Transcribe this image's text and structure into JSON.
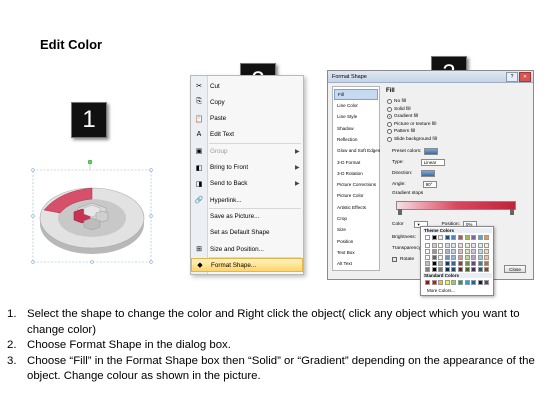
{
  "slide_title": "Edit Color",
  "badges": [
    "1",
    "2",
    "3"
  ],
  "context_menu": {
    "items": [
      {
        "label": "Cut",
        "icon": "scissors-icon",
        "glyph": "✂",
        "submenu": false,
        "disabled": false
      },
      {
        "label": "Copy",
        "icon": "copy-icon",
        "glyph": "⎘",
        "submenu": false,
        "disabled": false
      },
      {
        "label": "Paste",
        "icon": "paste-icon",
        "glyph": "📋",
        "submenu": false,
        "disabled": false
      },
      {
        "label": "Edit Text",
        "icon": "edit-text-icon",
        "glyph": "A",
        "submenu": false,
        "disabled": false
      },
      {
        "label": "Group",
        "icon": "group-icon",
        "glyph": "▣",
        "submenu": true,
        "disabled": true
      },
      {
        "label": "Bring to Front",
        "icon": "bring-front-icon",
        "glyph": "◧",
        "submenu": true,
        "disabled": false
      },
      {
        "label": "Send to Back",
        "icon": "send-back-icon",
        "glyph": "◨",
        "submenu": true,
        "disabled": false
      },
      {
        "label": "Hyperlink...",
        "icon": "hyperlink-icon",
        "glyph": "🔗",
        "submenu": false,
        "disabled": false
      },
      {
        "label": "Save as Picture...",
        "icon": "",
        "glyph": "",
        "submenu": false,
        "disabled": false
      },
      {
        "label": "Set as Default Shape",
        "icon": "",
        "glyph": "",
        "submenu": false,
        "disabled": false
      },
      {
        "label": "Size and Position...",
        "icon": "size-position-icon",
        "glyph": "⊞",
        "submenu": false,
        "disabled": false
      },
      {
        "label": "Format Shape...",
        "icon": "format-shape-icon",
        "glyph": "◆",
        "submenu": false,
        "disabled": false
      }
    ]
  },
  "format_dialog": {
    "title": "Format Shape",
    "categories": [
      "Fill",
      "Line Color",
      "Line Style",
      "Shadow",
      "Reflection",
      "Glow and Soft Edges",
      "3-D Format",
      "3-D Rotation",
      "Picture Corrections",
      "Picture Color",
      "Artistic Effects",
      "Crop",
      "Size",
      "Position",
      "Text Box",
      "Alt Text"
    ],
    "selected_category": "Fill",
    "pane_title": "Fill",
    "fill_options": [
      "No fill",
      "Solid fill",
      "Gradient fill",
      "Picture or texture fill",
      "Pattern fill",
      "Slide background fill"
    ],
    "selected_fill": "Gradient fill",
    "preset_colors_label": "Preset colors:",
    "type_label": "Type:",
    "type_value": "Linear",
    "direction_label": "Direction:",
    "angle_label": "Angle:",
    "angle_value": "90°",
    "gradient_stops_label": "Gradient stops",
    "color_label": "Color",
    "position_label": "Position:",
    "position_value": "0%",
    "brightness_label": "Brightness:",
    "transparency_label": "Transparency:",
    "rotate_label": "Rotate",
    "close_label": "Close"
  },
  "palette": {
    "theme_title": "Theme Colors",
    "standard_title": "Standard Colors",
    "more_label": "More Colors...",
    "theme_top": [
      "#ffffff",
      "#000000",
      "#eeece1",
      "#1f497d",
      "#4f81bd",
      "#c0504d",
      "#9bbb59",
      "#8064a2",
      "#4bacc6",
      "#f79646"
    ],
    "standard": [
      "#c00000",
      "#ff0000",
      "#ffc000",
      "#ffff00",
      "#92d050",
      "#00b050",
      "#00b0f0",
      "#0070c0",
      "#002060",
      "#7030a0"
    ]
  },
  "instructions": [
    {
      "num": "1.",
      "text": "Select the shape to change the color and Right click the object( click any object which you want to change color)"
    },
    {
      "num": "2.",
      "text": "Choose Format Shape in the dialog box."
    },
    {
      "num": "3.",
      "text": "Choose “Fill” in the Format Shape box then “Solid” or “Gradient” depending on the appearance of the object. Change colour as shown in the picture."
    }
  ]
}
